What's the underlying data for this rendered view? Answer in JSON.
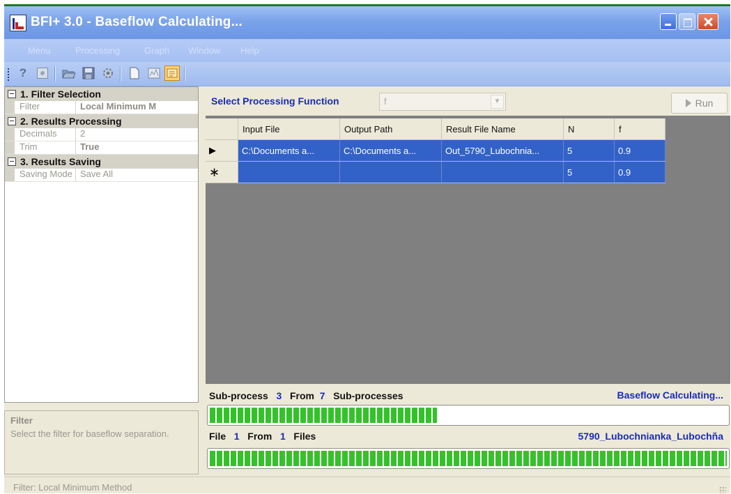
{
  "window": {
    "title": "BFI+ 3.0 - Baseflow Calculating..."
  },
  "menu": [
    "Menu",
    "Processing",
    "Graph",
    "Window",
    "Help"
  ],
  "toolbar": {
    "icons": [
      "help-icon",
      "stop-icon",
      "open-folder-icon",
      "save-icon",
      "settings-icon",
      "new-document-icon",
      "graph-icon",
      "processing-icon"
    ]
  },
  "property_grid": {
    "categories": [
      {
        "title": "1. Filter Selection",
        "rows": [
          {
            "label": "Filter",
            "value": "Local Minimum M"
          }
        ]
      },
      {
        "title": "2. Results Processing",
        "rows": [
          {
            "label": "Decimals",
            "value": "2"
          },
          {
            "label": "Trim",
            "value": "True"
          }
        ]
      },
      {
        "title": "3. Results Saving",
        "rows": [
          {
            "label": "Saving Mode",
            "value": "Save All"
          }
        ]
      }
    ],
    "help": {
      "title": "Filter",
      "text": "Select the filter for baseflow separation."
    }
  },
  "processing": {
    "label": "Select Processing Function",
    "value": "f",
    "run_label": "Run"
  },
  "grid": {
    "columns": [
      "Input File",
      "Output Path",
      "Result File Name",
      "N",
      "f"
    ],
    "rows": [
      {
        "marker": "▶",
        "cells": [
          "C:\\Documents a...",
          "C:\\Documents a...",
          "Out_5790_Lubochnia...",
          "5",
          "0.9"
        ]
      },
      {
        "marker": "∗",
        "cells": [
          "",
          "",
          "",
          "5",
          "0.9"
        ]
      }
    ]
  },
  "subprocess": {
    "label": "Sub-process",
    "current": "3",
    "from_label": "From",
    "total": "7",
    "suffix": "Sub-processes",
    "status": "Baseflow Calculating...",
    "progress": 0.44
  },
  "files": {
    "label": "File",
    "current": "1",
    "from_label": "From",
    "total": "1",
    "suffix": "Files",
    "name": "5790_Lubochnianka_Lubochňa",
    "progress": 1.0
  },
  "statusbar": {
    "text": "Filter:  Local Minimum Method"
  }
}
